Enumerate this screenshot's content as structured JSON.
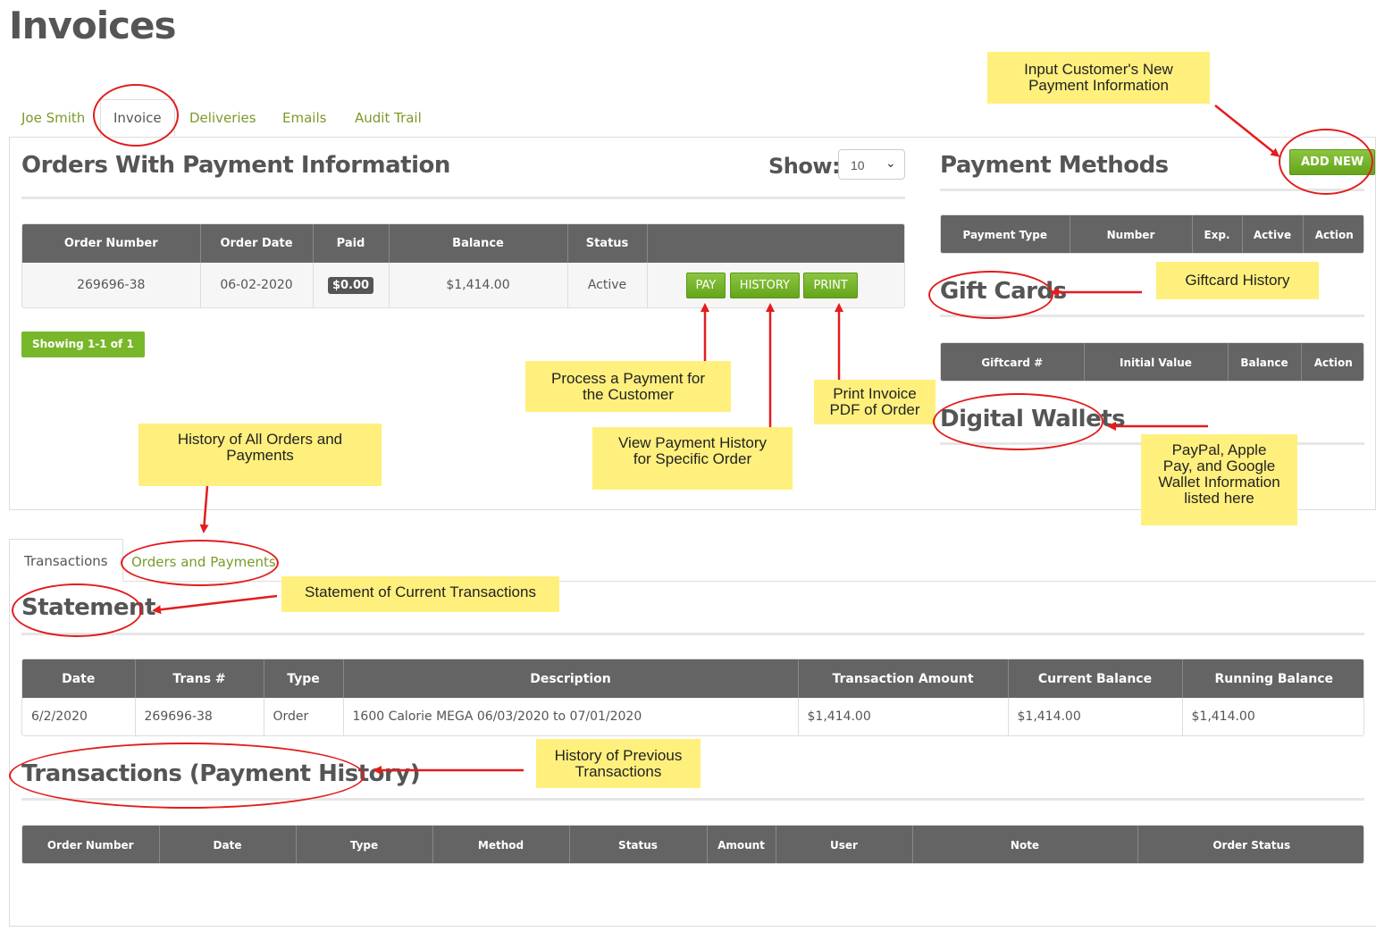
{
  "page": {
    "title": "Invoices"
  },
  "tabs": [
    "Joe Smith",
    "Invoice",
    "Deliveries",
    "Emails",
    "Audit Trail"
  ],
  "orders": {
    "title": "Orders With Payment Information",
    "show_label": "Show:",
    "show_value": "10",
    "columns": [
      "Order Number",
      "Order Date",
      "Paid",
      "Balance",
      "Status",
      ""
    ],
    "row": {
      "order_number": "269696-38",
      "order_date": "06-02-2020",
      "paid": "$0.00",
      "balance": "$1,414.00",
      "status": "Active"
    },
    "buttons": {
      "pay": "PAY",
      "history": "HISTORY",
      "print": "PRINT"
    },
    "showing": "Showing 1-1 of 1"
  },
  "payment_methods": {
    "title": "Payment Methods",
    "add_new": "ADD NEW",
    "columns": [
      "Payment Type",
      "Number",
      "Exp.",
      "Active",
      "Action"
    ]
  },
  "gift_cards": {
    "title": "Gift Cards",
    "columns": [
      "Giftcard #",
      "Initial Value",
      "Balance",
      "Action"
    ]
  },
  "digital_wallets": {
    "title": "Digital Wallets"
  },
  "lower_tabs": [
    "Transactions",
    "Orders and Payments"
  ],
  "statement": {
    "title": "Statement",
    "columns": [
      "Date",
      "Trans #",
      "Type",
      "Description",
      "Transaction Amount",
      "Current Balance",
      "Running Balance"
    ],
    "row": [
      "6/2/2020",
      "269696-38",
      "Order",
      "1600 Calorie MEGA 06/03/2020 to 07/01/2020",
      "$1,414.00",
      "$1,414.00",
      "$1,414.00"
    ]
  },
  "payment_history": {
    "title": "Transactions (Payment History)",
    "columns": [
      "Order Number",
      "Date",
      "Type",
      "Method",
      "Status",
      "Amount",
      "User",
      "Note",
      "Order Status"
    ]
  },
  "annotations": {
    "input_new_payment": [
      "Input Customer's New",
      "Payment Information"
    ],
    "giftcard_history": [
      "Giftcard History"
    ],
    "process_payment": [
      "Process a Payment for",
      "the Customer"
    ],
    "print_invoice": [
      "Print Invoice",
      "PDF of Order"
    ],
    "history_all": [
      "History of All Orders and",
      "Payments"
    ],
    "view_payment_history": [
      "View Payment History",
      "for Specific Order"
    ],
    "wallets": [
      "PayPal, Apple",
      "Pay, and Google",
      "Wallet Information",
      "listed here"
    ],
    "statement_current": [
      "Statement of Current Transactions"
    ],
    "history_previous": [
      "History of Previous",
      "Transactions"
    ]
  },
  "colors": {
    "accent_green": "#78b72a",
    "header_gray": "#646464",
    "annotation_red": "#e21d1d",
    "note_yellow": "#fff07e"
  }
}
